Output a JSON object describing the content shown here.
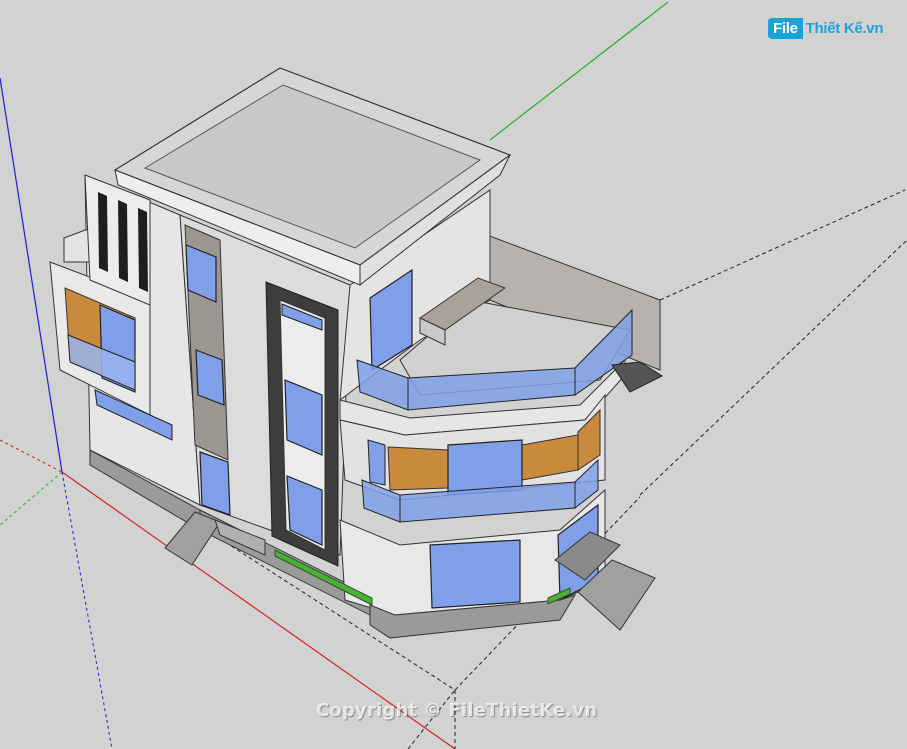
{
  "logo": {
    "part1": "File",
    "part2": "Thiết Kế.vn"
  },
  "watermark": "Copyright © FileThietKe.vn",
  "colors": {
    "background": "#d2d2d2",
    "axis_red": "#d42020",
    "axis_green": "#1fb21f",
    "axis_blue": "#1f1fd4",
    "glass": "#7fa0e8",
    "wood": "#c98a3e",
    "wall_light": "#ececec",
    "wall_mid": "#d9d9d9",
    "frame_dark": "#3d3d3d",
    "brand": "#1aa3d9"
  }
}
